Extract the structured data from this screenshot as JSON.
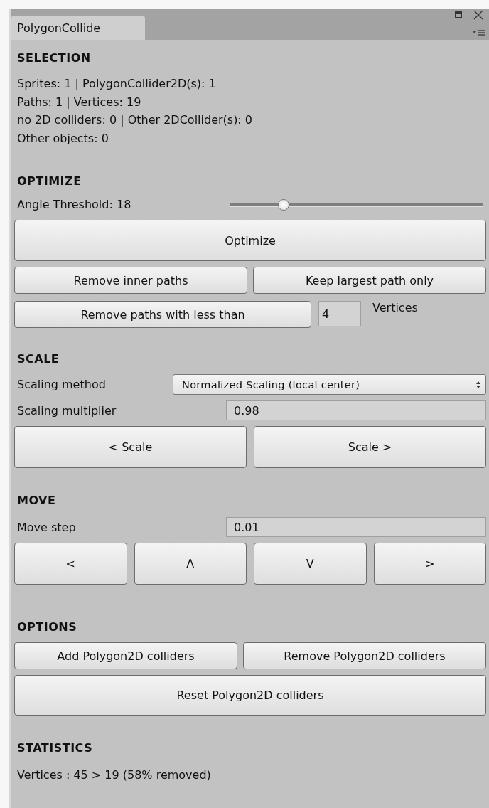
{
  "window": {
    "tab": "PolygonCollide",
    "selected": true
  },
  "selection": {
    "title": "SELECTION",
    "lines": [
      "Sprites: 1 | PolygonCollider2D(s): 1",
      "Paths: 1 | Vertices: 19",
      "no 2D colliders: 0 | Other 2DCollider(s): 0",
      "Other objects: 0"
    ]
  },
  "optimize": {
    "title": "OPTIMIZE",
    "angle_label": "Angle Threshold: 18",
    "angle_slider": {
      "level": 0.21
    },
    "optimize_button": "Optimize",
    "remove_inner": "Remove inner paths",
    "keep_largest": "Keep largest path only",
    "remove_less": "Remove paths with less than",
    "min_vertices": "4",
    "vertices_label": "Vertices"
  },
  "scale": {
    "title": "SCALE",
    "method_label": "Scaling method",
    "method_value": "Normalized Scaling (local center)",
    "multiplier_label": "Scaling multiplier",
    "multiplier_value": "0.98",
    "buttons": [
      "< Scale",
      "Scale >"
    ]
  },
  "move": {
    "title": "MOVE",
    "step_label": "Move step",
    "step_value": "0.01",
    "buttons": [
      "<",
      "Λ",
      "V",
      ">"
    ]
  },
  "options": {
    "title": "OPTIONS",
    "add": "Add Polygon2D colliders",
    "remove": "Remove Polygon2D colliders",
    "reset": "Reset Polygon2D colliders"
  },
  "statistics": {
    "title": "STATISTICS",
    "text": "Vertices : 45 > 19 (58% removed)"
  }
}
